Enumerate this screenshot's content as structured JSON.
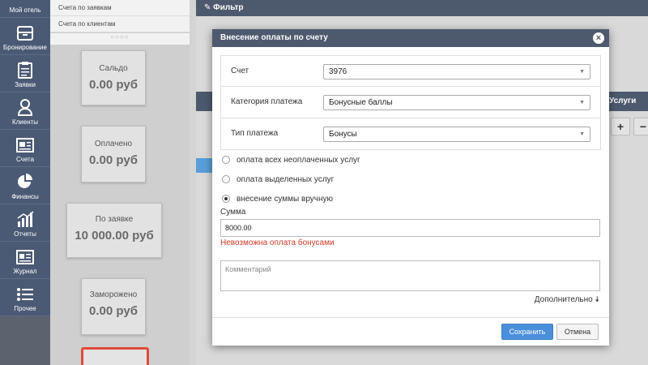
{
  "nav": {
    "items": [
      {
        "label": "Мой отель",
        "icon": "hotel-icon"
      },
      {
        "label": "Бронирование",
        "icon": "box-icon"
      },
      {
        "label": "Заявки",
        "icon": "clipboard-icon"
      },
      {
        "label": "Клиенты",
        "icon": "user-icon"
      },
      {
        "label": "Счета",
        "icon": "invoice-icon"
      },
      {
        "label": "Финансы",
        "icon": "pie-chart-icon"
      },
      {
        "label": "Отчеты",
        "icon": "bar-chart-icon"
      },
      {
        "label": "Журнал",
        "icon": "journal-icon"
      },
      {
        "label": "Прочее",
        "icon": "list-icon"
      }
    ]
  },
  "side": {
    "list": [
      "Счета по заявкам",
      "Счета по клиентам"
    ],
    "dots": "○○○○",
    "stats": [
      {
        "label": "Сальдо",
        "value": "0.00 руб"
      },
      {
        "label": "Оплачено",
        "value": "0.00 руб"
      },
      {
        "label": "По заявке",
        "value": "10 000.00 руб"
      },
      {
        "label": "Заморожено",
        "value": "0.00 руб"
      }
    ]
  },
  "main": {
    "filter_title": "Фильтр",
    "services_title": "Услуги",
    "plus": "+",
    "minus": "−"
  },
  "modal": {
    "title": "Внесение оплаты по счету",
    "close": "×",
    "fields": [
      {
        "label": "Счет",
        "value": "3976"
      },
      {
        "label": "Категория платежа",
        "value": "Бонусные баллы"
      },
      {
        "label": "Тип платежа",
        "value": "Бонусы"
      }
    ],
    "radios": [
      {
        "label": "оплата всех неоплаченных услуг",
        "checked": false
      },
      {
        "label": "оплата выделенных услуг",
        "checked": false
      },
      {
        "label": "внесение суммы вручную",
        "checked": true
      }
    ],
    "sum_label": "Сумма",
    "sum_value": "8000.00",
    "error": "Невозможна оплата бонусами",
    "comment_placeholder": "Комментарий",
    "more_label": "Дополнительно",
    "save_label": "Сохранить",
    "cancel_label": "Отмена"
  },
  "colors": {
    "nav_bg": "#4a5a74",
    "header_bg": "#4d5a6e",
    "primary_button": "#4a8fdc",
    "error": "#d03a2a",
    "highlight_border": "#e04a3a"
  }
}
